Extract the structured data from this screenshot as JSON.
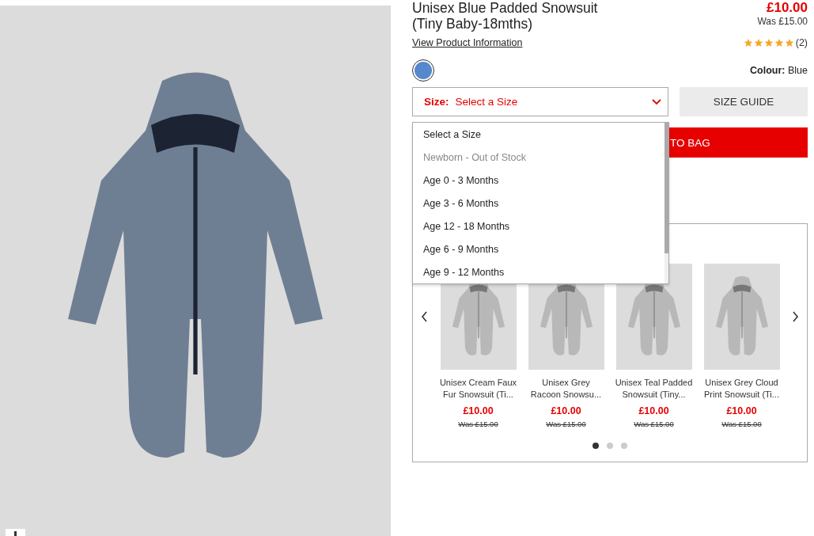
{
  "product": {
    "title": "Unisex Blue Padded Snowsuit (Tiny Baby-18mths)",
    "price": "£10.00",
    "was_price": "Was £15.00",
    "info_link": "View Product Information",
    "stars": 5,
    "review_count": "(2)"
  },
  "colour": {
    "label": "Colour:",
    "value": "Blue",
    "swatches": [
      {
        "color": "#5588cc",
        "selected": true
      }
    ]
  },
  "size_select": {
    "label": "Size:",
    "value": "Select a Size",
    "expanded": true,
    "options": [
      {
        "label": "Select a Size",
        "disabled": false
      },
      {
        "label": "Newborn - Out of Stock",
        "disabled": true
      },
      {
        "label": "Age 0 - 3 Months",
        "disabled": false
      },
      {
        "label": "Age 3 - 6 Months",
        "disabled": false
      },
      {
        "label": "Age 12 - 18 Months",
        "disabled": false
      },
      {
        "label": "Age 6 - 9 Months",
        "disabled": false
      },
      {
        "label": "Age 9 - 12 Months",
        "disabled": false
      }
    ]
  },
  "size_guide": "SIZE GUIDE",
  "add_button": "TO BAG",
  "recommendations": {
    "items": [
      {
        "name": "Unisex Cream Faux Fur Snowsuit (Ti...",
        "price": "£10.00",
        "was_price": "Was £15.00"
      },
      {
        "name": "Unisex Grey Racoon Snowsu...",
        "price": "£10.00",
        "was_price": "Was £15.00"
      },
      {
        "name": "Unisex Teal Padded Snowsuit (Tiny...",
        "price": "£10.00",
        "was_price": "Was £15.00"
      },
      {
        "name": "Unisex Grey Cloud Print Snowsuit (Ti...",
        "price": "£10.00",
        "was_price": "Was £15.00"
      }
    ],
    "pages": [
      {
        "selected": true
      },
      {
        "selected": false
      },
      {
        "selected": false
      }
    ]
  }
}
